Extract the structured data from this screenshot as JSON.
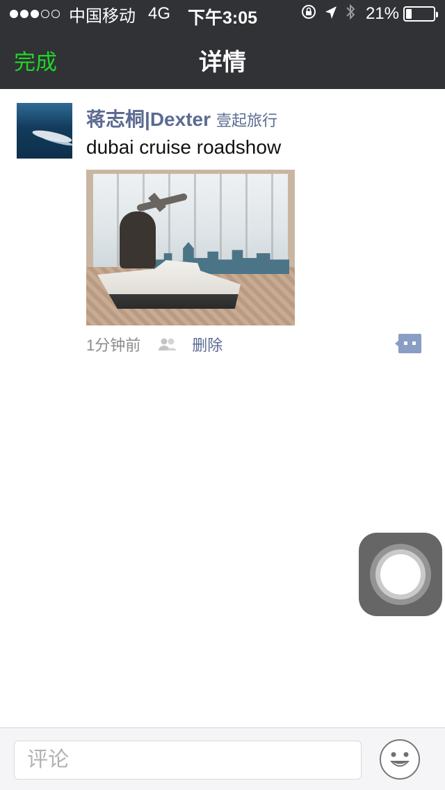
{
  "status_bar": {
    "signal_dots_filled": 3,
    "signal_dots_total": 5,
    "carrier": "中国移动",
    "network": "4G",
    "time": "下午3:05",
    "battery_percent_text": "21%",
    "battery_level": 0.21,
    "icons": [
      "orientation-lock-icon",
      "location-arrow-icon",
      "bluetooth-icon",
      "battery-icon"
    ]
  },
  "nav": {
    "done_label": "完成",
    "title": "详情",
    "done_color": "#1fd625",
    "bar_color": "#313236"
  },
  "post": {
    "author_name": "蒋志桐|Dexter",
    "author_company": "壹起旅行",
    "text": "dubai cruise roadshow",
    "time_ago": "1分钟前",
    "delete_label": "删除",
    "link_color": "#5b6b91",
    "icons": [
      "friends-visibility-icon",
      "comment-bubble-icon"
    ]
  },
  "comment_bar": {
    "placeholder": "评论",
    "icons": [
      "emoji-icon"
    ]
  },
  "assistive_touch": {
    "icon": "assistive-touch-icon"
  }
}
